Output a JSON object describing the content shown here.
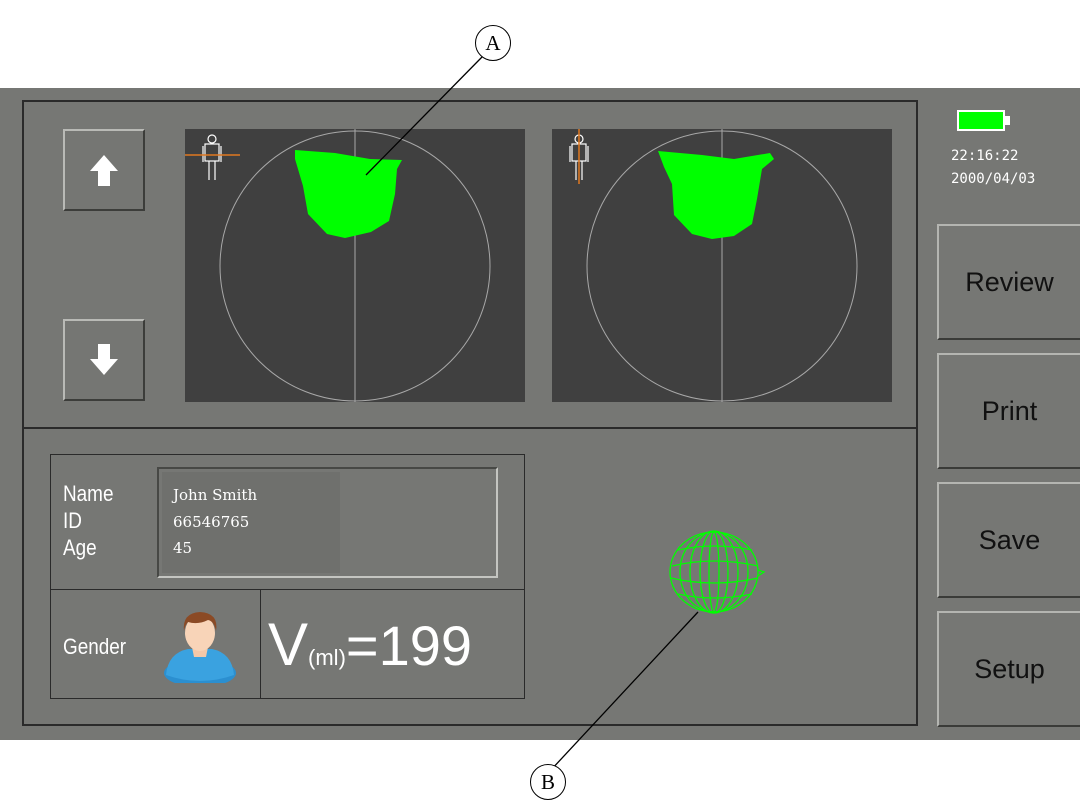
{
  "status": {
    "time": "22:16:22",
    "date": "2000/04/03",
    "battery_icon": "battery-full-icon",
    "battery_color": "#00ff00"
  },
  "navigation": {
    "up_icon": "arrow-up-icon",
    "down_icon": "arrow-down-icon"
  },
  "side_menu": {
    "review": "Review",
    "print": "Print",
    "save": "Save",
    "setup": "Setup"
  },
  "patient": {
    "name_label": "Name",
    "id_label": "ID",
    "age_label": "Age",
    "name": "John Smith",
    "id": "66546765",
    "age": "45",
    "gender_label": "Gender",
    "gender_icon": "male-avatar-icon"
  },
  "volume": {
    "prefix": "V",
    "unit": "(ml)",
    "value": "=199"
  },
  "scans": {
    "left_view": "transverse",
    "right_view": "sagittal",
    "bladder_color": "#00ff00",
    "orientation_line_color": "#e07820"
  },
  "callouts": {
    "a": "A",
    "b": "B"
  }
}
